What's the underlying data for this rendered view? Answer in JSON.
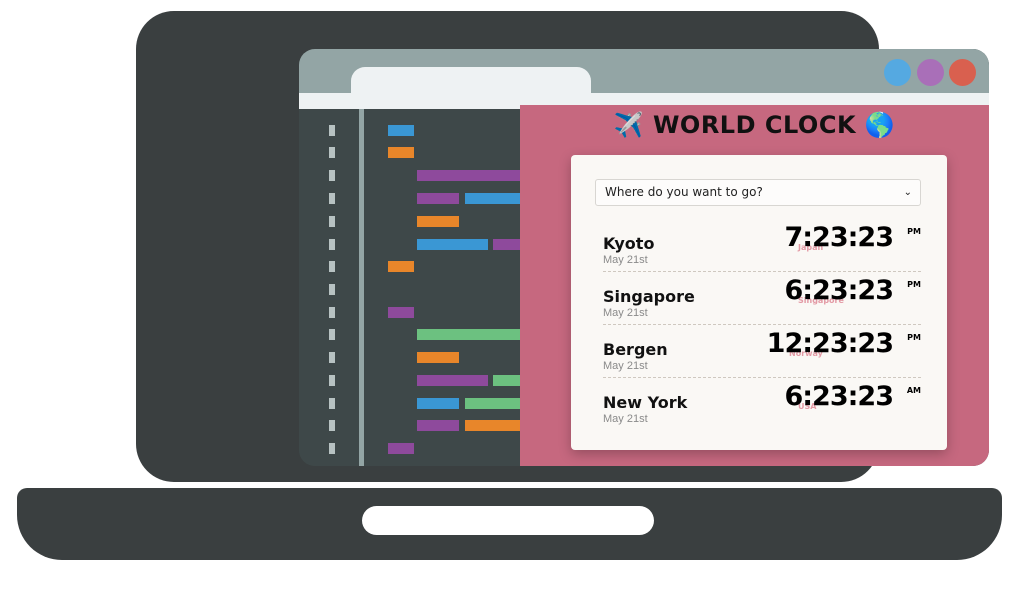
{
  "app": {
    "title_emoji_left": "✈️",
    "title": "WORLD CLOCK",
    "title_emoji_right": "🌎"
  },
  "select": {
    "placeholder": "Where do you want to go?",
    "chevron": "⌄"
  },
  "clocks": [
    {
      "city": "Kyoto",
      "date": "May 21st",
      "time": "7:23:23",
      "period": "PM",
      "country": "Japan"
    },
    {
      "city": "Singapore",
      "date": "May 21st",
      "time": "6:23:23",
      "period": "PM",
      "country": "Singapore"
    },
    {
      "city": "Bergen",
      "date": "May 21st",
      "time": "12:23:23",
      "period": "PM",
      "country": "Norway"
    },
    {
      "city": "New York",
      "date": "May 21st",
      "time": "6:23:23",
      "period": "AM",
      "country": "USA"
    }
  ],
  "colors": {
    "laptop": "#3a3f40",
    "app_background": "#c6687f",
    "card": "#faf8f5",
    "country_label": "#e39aa5",
    "window_dot_blue": "#55a9e1",
    "window_dot_purple": "#a96fb8",
    "window_dot_red": "#d9604f"
  }
}
